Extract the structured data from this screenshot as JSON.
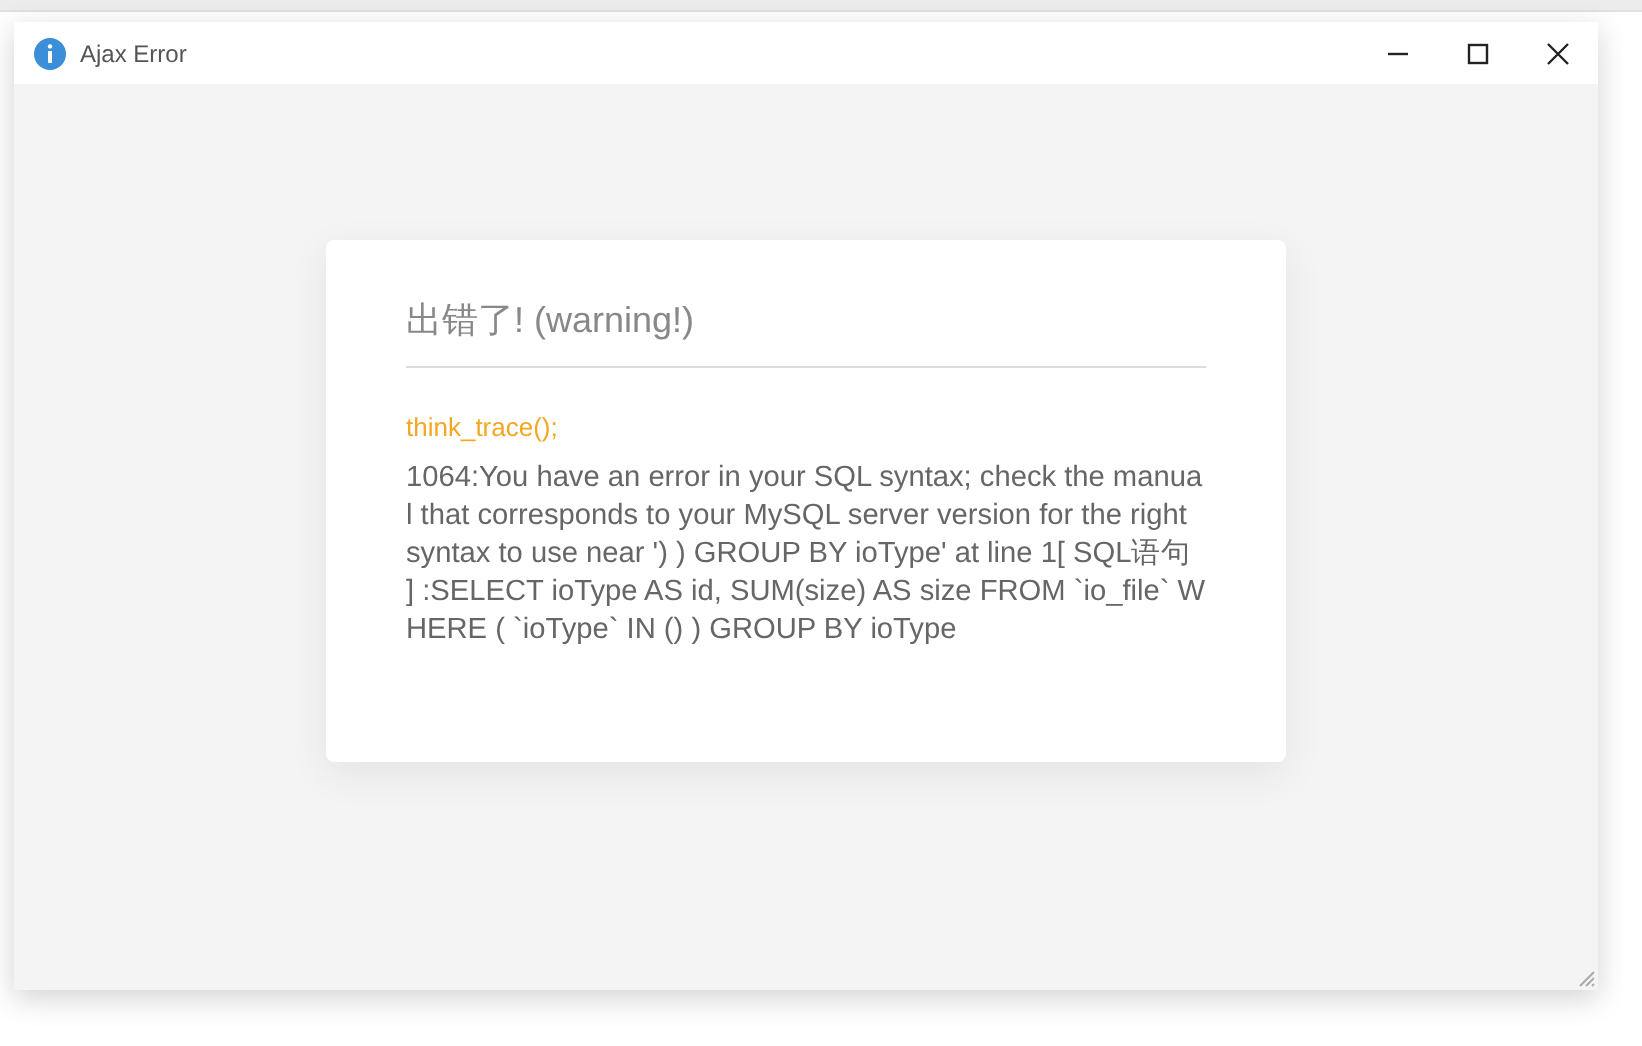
{
  "window": {
    "title": "Ajax Error"
  },
  "error": {
    "heading": "出错了! (warning!)",
    "trace": "think_trace();",
    "message": "1064:You have an error in your SQL syntax; check the manual that corresponds to your MySQL server version for the right syntax to use near ') ) GROUP BY ioType' at line 1[ SQL语句 ] :SELECT ioType AS id, SUM(size) AS size FROM `io_file` WHERE ( `ioType` IN () ) GROUP BY ioType"
  }
}
